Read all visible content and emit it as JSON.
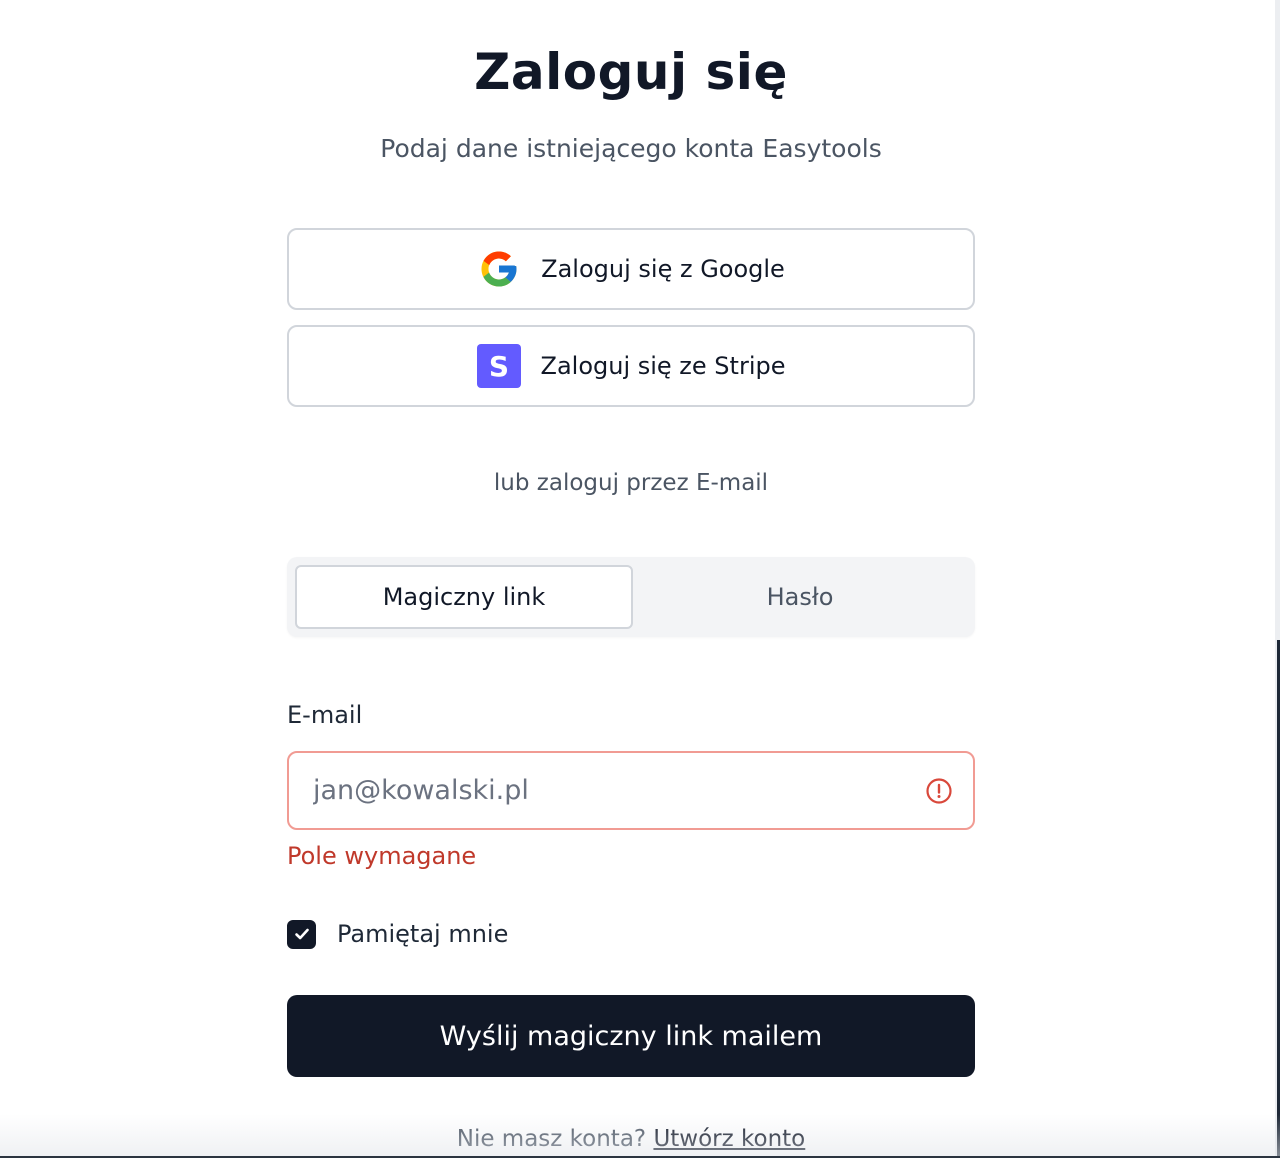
{
  "header": {
    "title": "Zaloguj się",
    "subtitle": "Podaj dane istniejącego konta Easytools"
  },
  "oauth": {
    "google_label": "Zaloguj się z Google",
    "google_icon": "google-icon",
    "stripe_label": "Zaloguj się ze Stripe",
    "stripe_icon": "stripe-icon",
    "stripe_letter": "S",
    "stripe_color": "#635bff"
  },
  "divider": {
    "text": "lub zaloguj przez E-mail"
  },
  "tabs": [
    {
      "label": "Magiczny link",
      "active": true
    },
    {
      "label": "Hasło",
      "active": false
    }
  ],
  "email": {
    "label": "E-mail",
    "value": "",
    "placeholder": "jan@kowalski.pl",
    "error": "Pole wymagane",
    "error_color": "#c0392b"
  },
  "remember": {
    "label": "Pamiętaj mnie",
    "checked": true
  },
  "submit": {
    "label": "Wyślij magiczny link mailem",
    "color": "#111827"
  },
  "footer": {
    "prompt": "Nie masz konta?",
    "link": "Utwórz konto"
  }
}
